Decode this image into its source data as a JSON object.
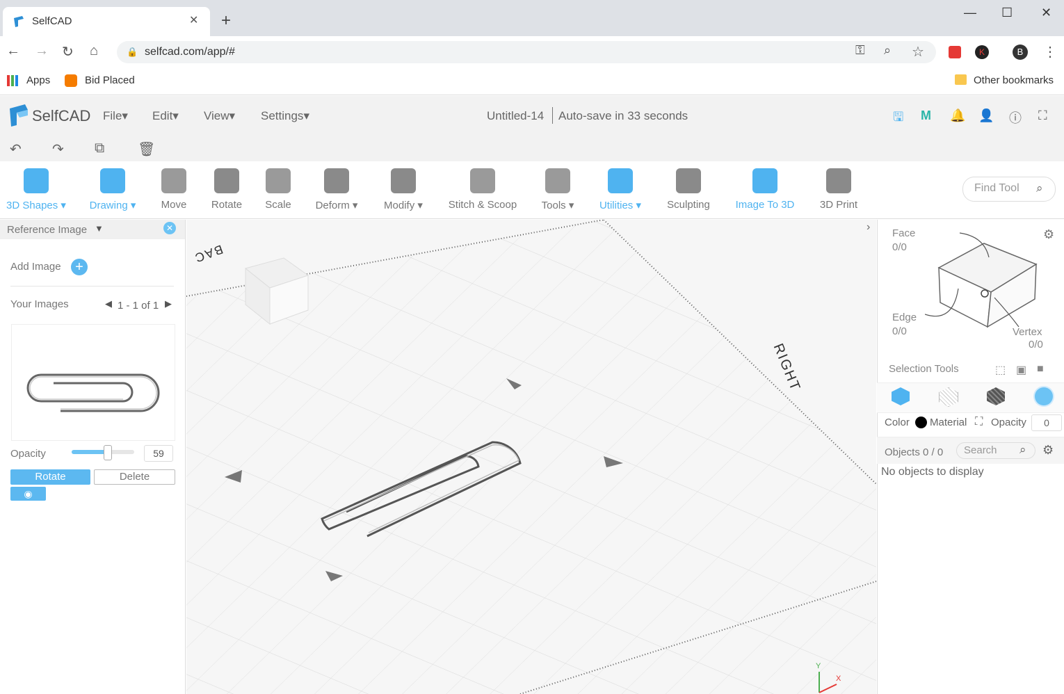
{
  "browser": {
    "tab_title": "SelfCAD",
    "url": "selfcad.com/app/#",
    "bookmarks": [
      "Apps",
      "Bid Placed"
    ],
    "other_bookmarks": "Other bookmarks",
    "profile_initial": "B",
    "extension_initial": "K"
  },
  "app": {
    "logo": "SelfCAD",
    "menus": [
      "File",
      "Edit",
      "View",
      "Settings"
    ],
    "doc_title": "Untitled-14",
    "autosave": "Auto-save in 33 seconds"
  },
  "toolbar": {
    "tools": [
      {
        "label": "3D Shapes",
        "dropdown": true,
        "color": "#4fb3f0",
        "active": true
      },
      {
        "label": "Drawing",
        "dropdown": true,
        "color": "#4fb3f0",
        "active": true
      },
      {
        "label": "Move",
        "dropdown": false,
        "color": "#9a9a9a",
        "active": false
      },
      {
        "label": "Rotate",
        "dropdown": false,
        "color": "#8a8a8a",
        "active": false
      },
      {
        "label": "Scale",
        "dropdown": false,
        "color": "#9a9a9a",
        "active": false
      },
      {
        "label": "Deform",
        "dropdown": true,
        "color": "#8a8a8a",
        "active": false
      },
      {
        "label": "Modify",
        "dropdown": true,
        "color": "#8a8a8a",
        "active": false
      },
      {
        "label": "Stitch & Scoop",
        "dropdown": false,
        "color": "#9a9a9a",
        "active": false
      },
      {
        "label": "Tools",
        "dropdown": true,
        "color": "#9a9a9a",
        "active": false
      },
      {
        "label": "Utilities",
        "dropdown": true,
        "color": "#4fb3f0",
        "active": true
      },
      {
        "label": "Sculpting",
        "dropdown": false,
        "color": "#8a8a8a",
        "active": false
      },
      {
        "label": "Image To 3D",
        "dropdown": false,
        "color": "#4fb3f0",
        "active": true
      },
      {
        "label": "3D Print",
        "dropdown": false,
        "color": "#8a8a8a",
        "active": false
      }
    ],
    "find_tool": "Find Tool"
  },
  "left_panel": {
    "title": "Reference Image",
    "add_image": "Add Image",
    "your_images": "Your Images",
    "pagination": "1 - 1 of 1",
    "opacity_label": "Opacity",
    "opacity_value": "59",
    "rotate": "Rotate",
    "delete": "Delete"
  },
  "viewport": {
    "labels": {
      "right": "RIGHT",
      "back": "BAC",
      "y_axis": "Y",
      "x_axis": "X"
    }
  },
  "right_panel": {
    "face": {
      "label": "Face",
      "value": "0/0"
    },
    "edge": {
      "label": "Edge",
      "value": "0/0"
    },
    "vertex": {
      "label": "Vertex",
      "value": "0/0"
    },
    "selection_tools": "Selection Tools",
    "color_label": "Color",
    "material_label": "Material",
    "opacity_label": "Opacity",
    "opacity_value": "0",
    "objects": "Objects 0 / 0",
    "search_placeholder": "Search",
    "empty": "No objects to display"
  }
}
